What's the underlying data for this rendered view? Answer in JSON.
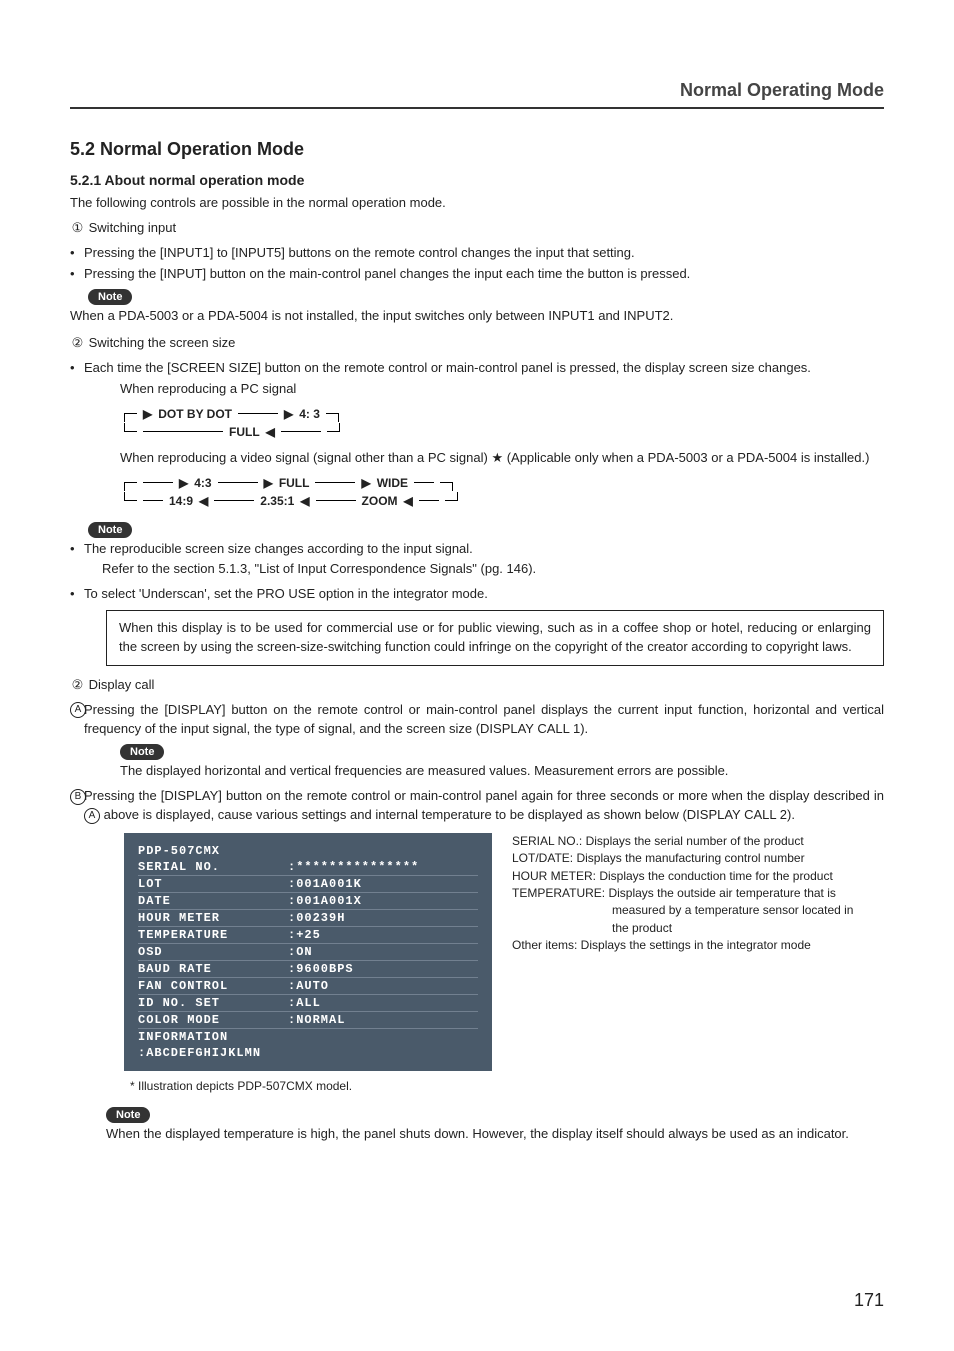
{
  "header": {
    "running_title": "Normal Operating Mode"
  },
  "section": {
    "number_title": "5.2 Normal Operation Mode",
    "sub_number_title": "5.2.1 About normal operation mode",
    "intro": "The following controls are possible in the normal operation mode."
  },
  "items": {
    "one": {
      "marker": "①",
      "title": "Switching input",
      "b1": "Pressing the [INPUT1] to [INPUT5] buttons on the remote control changes the input that setting.",
      "b2": "Pressing the [INPUT] button on the main-control panel changes the input each time the button is pressed.",
      "note_label": "Note",
      "note_text": "When a PDA-5003 or a PDA-5004 is not installed, the input switches only between INPUT1 and INPUT2."
    },
    "two": {
      "marker": "②",
      "title": "Switching the screen size",
      "b1": "Each time the [SCREEN SIZE] button on the remote control or main-control panel is pressed, the display screen size changes.",
      "pc_label": "When reproducing a PC signal",
      "pc_flow": {
        "a": "DOT BY DOT",
        "b": "4: 3",
        "c": "FULL"
      },
      "video_label_a": "When reproducing a video signal (signal other than a PC signal) ",
      "video_star": "★",
      "video_label_b": " (Applicable only when a PDA-5003 or a PDA-5004 is installed.)",
      "video_flow": {
        "a": "4:3",
        "b": "FULL",
        "c": "WIDE",
        "d": "ZOOM",
        "e": "2.35:1",
        "f": "14:9"
      },
      "note_label": "Note",
      "note_b1": "The reproducible screen size changes according to the input signal.",
      "note_b1b": "Refer to the section 5.1.3, \"List of Input Correspondence Signals\" (pg. 146).",
      "note_b2": "To select 'Underscan', set the PRO USE option in the integrator mode.",
      "warn_box": "When this display is to be used for commercial use or for public viewing, such as in a coffee shop or hotel, reducing or enlarging the screen by using the screen-size-switching function could infringe on the copyright of the creator according to copyright laws."
    },
    "three": {
      "marker": "②",
      "title": "Display call",
      "A_marker": "A",
      "A_text": "Pressing the [DISPLAY] button on the remote control or main-control panel displays the current input function, horizontal and vertical frequency of the input signal, the type of signal, and the screen size (DISPLAY CALL 1).",
      "A_note_label": "Note",
      "A_note_text": "The displayed horizontal and vertical frequencies are measured values. Measurement errors are possible.",
      "B_marker": "B",
      "B_text_a": "Pressing the [DISPLAY] button on the remote control or main-control panel again for three seconds or more when the display described in ",
      "B_text_b": " above is displayed, cause various settings and internal temperature to be displayed as shown below (DISPLAY CALL 2)."
    }
  },
  "display_panel": {
    "model": "PDP-507CMX",
    "rows": [
      {
        "k": "SERIAL NO.",
        "v": ":***************"
      },
      {
        "k": "LOT",
        "v": ":001A001K"
      },
      {
        "k": "DATE",
        "v": ":001A001X"
      },
      {
        "k": "HOUR METER",
        "v": ":00239H"
      },
      {
        "k": "TEMPERATURE",
        "v": ":+25"
      },
      {
        "k": "OSD",
        "v": ":ON"
      },
      {
        "k": "BAUD RATE",
        "v": ":9600BPS"
      },
      {
        "k": "FAN CONTROL",
        "v": ":AUTO"
      },
      {
        "k": "ID NO. SET",
        "v": ":ALL"
      },
      {
        "k": "COLOR MODE",
        "v": ":NORMAL"
      },
      {
        "k": "INFORMATION",
        "v": ""
      },
      {
        "k": ":ABCDEFGHIJKLMN",
        "v": ""
      }
    ]
  },
  "side_desc": {
    "l1": "SERIAL NO.: Displays the serial number of the product",
    "l2": "LOT/DATE: Displays the manufacturing control number",
    "l3": "HOUR METER: Displays the conduction time for the product",
    "l4a": "TEMPERATURE: Displays the outside air temperature that is",
    "l4b": "measured by a temperature sensor located in",
    "l4c": "the product",
    "l5": "Other items: Displays the settings in the integrator mode"
  },
  "caption": "* Illustration depicts PDP-507CMX model.",
  "final_note": {
    "label": "Note",
    "text": "When the displayed temperature is high, the panel shuts down. However, the display itself should always be used as an indicator."
  },
  "page_number": "171"
}
